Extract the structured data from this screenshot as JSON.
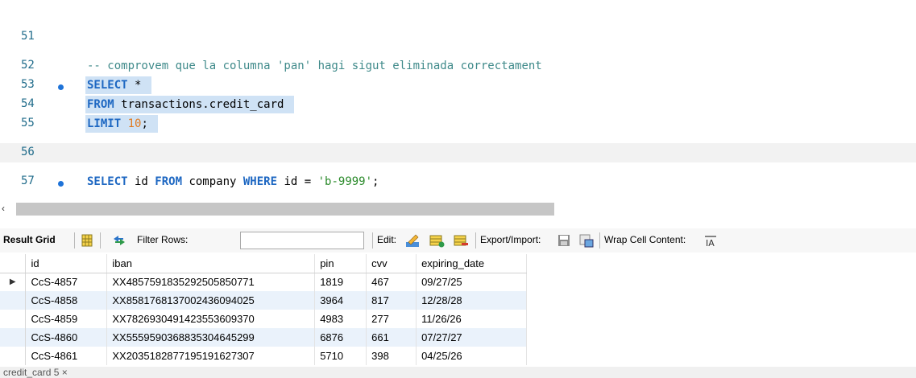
{
  "editor": {
    "lines": [
      {
        "num": "51",
        "text": ""
      },
      {
        "num": "52",
        "comment": "-- comprovem que la columna 'pan' hagi sigut eliminada correctament"
      },
      {
        "num": "53",
        "kw1": "SELECT",
        "rest": " *"
      },
      {
        "num": "54",
        "kw1": "FROM",
        "rest": " transactions.credit_card"
      },
      {
        "num": "55",
        "kw1": "LIMIT",
        "num_val": "10",
        "tail": ";"
      },
      {
        "num": "56",
        "text": ""
      },
      {
        "num": "57",
        "kw1": "SELECT",
        "p1": " id ",
        "kw2": "FROM",
        "p2": " company ",
        "kw3": "WHERE",
        "p3": " id = ",
        "str": "'b-9999'",
        "tail": ";"
      }
    ]
  },
  "toolbar": {
    "result_grid": "Result Grid",
    "filter_rows": "Filter Rows:",
    "filter_value": "",
    "edit": "Edit:",
    "export_import": "Export/Import:",
    "wrap_cell": "Wrap Cell Content:"
  },
  "grid": {
    "columns": [
      "id",
      "iban",
      "pin",
      "cvv",
      "expiring_date"
    ],
    "rows": [
      [
        "CcS-4857",
        "XX485759183529250585077​1",
        "1819",
        "467",
        "09/27/25"
      ],
      [
        "CcS-4858",
        "XX858176813700243609402​5",
        "3964",
        "817",
        "12/28/28"
      ],
      [
        "CcS-4859",
        "XX782693049142355360937​0",
        "4983",
        "277",
        "11/26/26"
      ],
      [
        "CcS-4860",
        "XX555959036883530464529​9",
        "6876",
        "661",
        "07/27/27"
      ],
      [
        "CcS-4861",
        "XX203518287719519162730​7",
        "5710",
        "398",
        "04/25/26"
      ]
    ]
  },
  "bottom_tab": "credit_card 5 ×",
  "colors": {
    "selection": "#cfe2f5",
    "keyword": "#1d67c2",
    "comment": "#3f8a8a",
    "number": "#e07a1f",
    "string": "#2a8a2a",
    "row_alt": "#eaf2fb"
  }
}
